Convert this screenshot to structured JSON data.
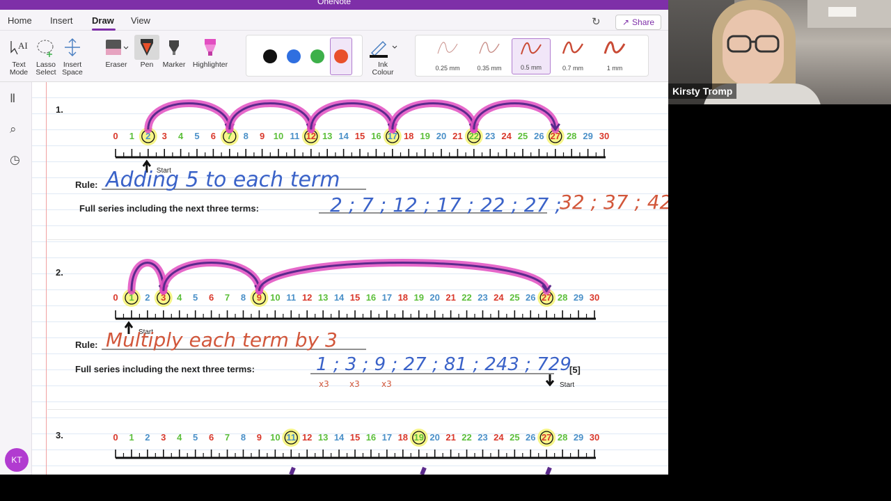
{
  "app": {
    "title": "OneNote"
  },
  "menu": {
    "items": [
      "Home",
      "Insert",
      "Draw",
      "View"
    ],
    "active": "Draw",
    "share_label": "Share"
  },
  "ribbon": {
    "tools": [
      {
        "name": "text-mode",
        "label_1": "Text",
        "label_2": "Mode"
      },
      {
        "name": "lasso-select",
        "label_1": "Lasso",
        "label_2": "Select"
      },
      {
        "name": "insert-space",
        "label_1": "Insert",
        "label_2": "Space"
      },
      {
        "name": "eraser",
        "label_1": "Eraser",
        "label_2": ""
      },
      {
        "name": "pen",
        "label_1": "Pen",
        "label_2": "",
        "selected": true
      },
      {
        "name": "marker",
        "label_1": "Marker",
        "label_2": ""
      },
      {
        "name": "highlighter",
        "label_1": "Highlighter",
        "label_2": ""
      }
    ],
    "colors": [
      "#111111",
      "#2f6fe0",
      "#3db04a",
      "#e8502b"
    ],
    "selected_color": "#e8502b",
    "ink_colour": {
      "label_1": "Ink",
      "label_2": "Colour"
    },
    "thicknesses": [
      "0.25 mm",
      "0.35 mm",
      "0.5 mm",
      "0.7 mm",
      "1 mm"
    ],
    "selected_thickness": "0.5 mm"
  },
  "user": {
    "initials": "KT"
  },
  "video": {
    "participant_name": "Kirsty Tromp"
  },
  "worksheet": {
    "digit_colors": {
      "red": "#d9382b",
      "green": "#5cbf3a",
      "blue": "#4a90c8"
    },
    "start_label": "Start",
    "rule_label": "Rule:",
    "series_label": "Full series including the next three terms:",
    "marks_label": "[5]",
    "questions": [
      {
        "number": "1.",
        "circled": [
          2,
          7,
          12,
          17,
          22,
          27
        ],
        "rule_text": "Adding 5 to each term",
        "series_text": "2 ; 7 ; 12 ; 17 ; 22 ; 27 ;",
        "next_terms_text": "32 ; 37 ; 42"
      },
      {
        "number": "2.",
        "circled": [
          1,
          3,
          9,
          27
        ],
        "rule_text": "Multiply each term by 3",
        "series_text": "1 ; 3 ; 9 ; 27 ; 81 ; 243 ; 729",
        "annotation": "x3"
      },
      {
        "number": "3.",
        "circled": [
          11,
          19,
          27
        ]
      }
    ]
  }
}
